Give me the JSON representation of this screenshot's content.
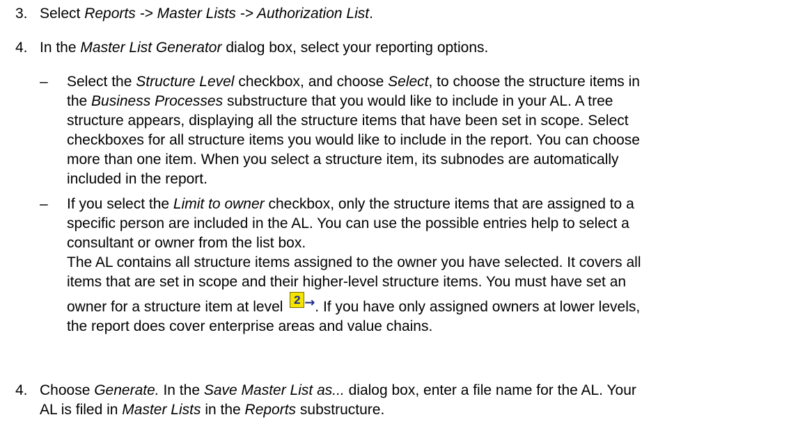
{
  "steps": [
    {
      "number": "3.",
      "parts": [
        "Select ",
        "Reports -> Master Lists -> Authorization List",
        "."
      ]
    },
    {
      "number": "4.",
      "parts": [
        "In the ",
        "Master List Generator",
        " dialog box, select your reporting options."
      ],
      "bullets": [
        {
          "dash": "–",
          "l1": [
            "Select the ",
            "Structure Level",
            " checkbox, and choose ",
            "Select",
            ", to choose the structure items in"
          ],
          "l2": [
            "the ",
            "Business Processes",
            " substructure that you would like to include in your AL. A tree"
          ],
          "l3": "structure appears, displaying all the structure items that have been set in scope. Select",
          "l4": "checkboxes for all structure items you would like to include in the report. You can choose",
          "l5": "more than one item. When you select a structure item, its subnodes are automatically",
          "l6": "included in the report."
        },
        {
          "dash": "–",
          "l1": [
            "If you select the ",
            "Limit to owner",
            " checkbox, only the structure items that are assigned to a"
          ],
          "l2": "specific person are included in the AL. You can use the possible entries help to select a",
          "l3": "consultant or owner from the list box.",
          "l4": "The AL contains all structure items assigned to the owner you have selected. It covers all",
          "l5": "items that are set in scope and their higher-level structure items.  You must have set an",
          "l6a": "owner for a structure item at level ",
          "l6b": ". If you have only assigned owners at lower levels,",
          "l7": "the report does cover enterprise areas and value chains.",
          "icon": {
            "name": "structure-level-2-icon",
            "glyph": "2",
            "arrow": "→",
            "color": "#f5e400"
          }
        }
      ]
    },
    {
      "number": "4.",
      "l1": [
        "Choose ",
        "Generate.",
        " In the ",
        "Save Master List as...",
        " dialog box, enter a file name for the AL. Your"
      ],
      "l2": [
        "AL is filed in ",
        "Master Lists",
        " in the ",
        "Reports",
        " substructure."
      ]
    }
  ]
}
